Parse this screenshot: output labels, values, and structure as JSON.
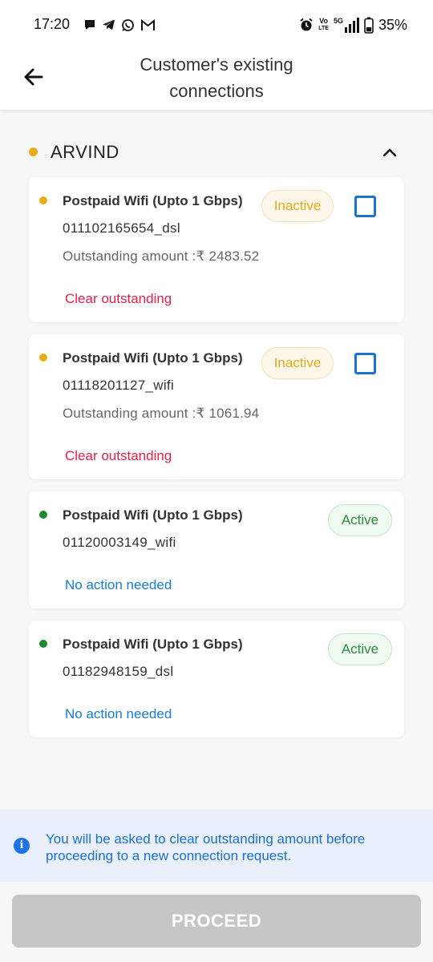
{
  "status_bar": {
    "time": "17:20",
    "battery": "35%",
    "network_vo": "Vo",
    "network_lte": "LTE",
    "network_5g": "5G",
    "icons": [
      "chat-icon",
      "telegram-icon",
      "whatsapp-icon",
      "gmail-icon",
      "alarm-icon",
      "signal-icon",
      "battery-icon"
    ]
  },
  "header": {
    "title_line1": "Customer's existing",
    "title_line2": "connections",
    "back_icon": "arrow-left-icon"
  },
  "customer": {
    "name": "ARVIND",
    "dot_color": "#e9ad18",
    "collapse_icon": "chevron-up-icon"
  },
  "connections": [
    {
      "title": "Postpaid Wifi (Upto 1 Gbps)",
      "id": "011102165654_dsl",
      "status": "Inactive",
      "outstanding": "Outstanding amount :₹ 2483.52",
      "action": "Clear outstanding",
      "action_color": "#e0224a",
      "dot_color": "#e9ad18",
      "selectable": true,
      "checked": false
    },
    {
      "title": "Postpaid Wifi (Upto 1 Gbps)",
      "id": "01118201127_wifi",
      "status": "Inactive",
      "outstanding": "Outstanding amount :₹ 1061.94",
      "action": "Clear outstanding",
      "action_color": "#e0224a",
      "dot_color": "#e9ad18",
      "selectable": true,
      "checked": false
    },
    {
      "title": "Postpaid Wifi (Upto 1 Gbps)",
      "id": "01120003149_wifi",
      "status": "Active",
      "action": "No action needed",
      "action_color": "#1b7ac9",
      "dot_color": "#1e8a2e",
      "selectable": false
    },
    {
      "title": "Postpaid Wifi (Upto 1 Gbps)",
      "id": "01182948159_dsl",
      "status": "Active",
      "action": "No action needed",
      "action_color": "#1b7ac9",
      "dot_color": "#1e8a2e",
      "selectable": false
    }
  ],
  "info": {
    "icon": "info-icon",
    "text": "You will be asked to clear outstanding amount before proceeding to a new connection request."
  },
  "proceed": {
    "label": "PROCEED",
    "disabled": true
  },
  "colors": {
    "accent_blue": "#1b73cf",
    "inactive": "#e3a81a",
    "active": "#2e8b3f",
    "danger": "#e0224a",
    "disabled_button": "#c6c6c6"
  }
}
